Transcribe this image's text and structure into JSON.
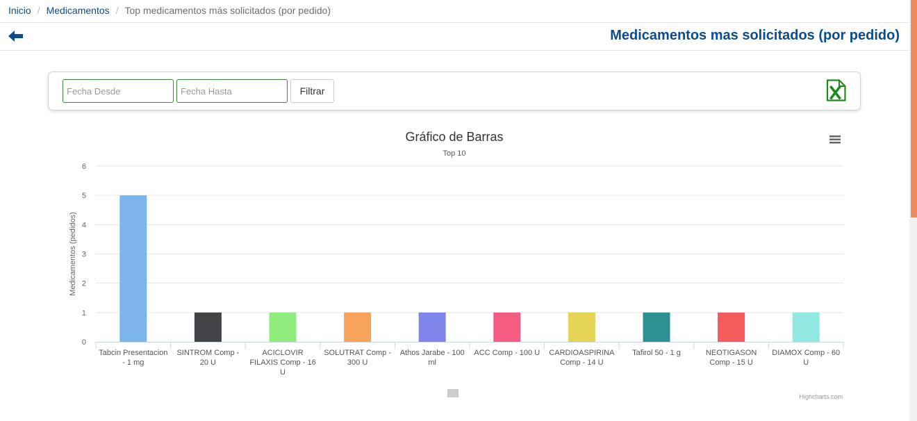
{
  "breadcrumb": {
    "items": [
      "Inicio",
      "Medicamentos"
    ],
    "current": "Top medicamentos más solicitados (por pedido)",
    "separator": "/"
  },
  "header": {
    "title": "Medicamentos mas solicitados (por pedido)",
    "back_icon": "arrow-left-icon"
  },
  "filters": {
    "fecha_desde_placeholder": "Fecha Desde",
    "fecha_hasta_placeholder": "Fecha Hasta",
    "filter_button": "Filtrar",
    "export_icon": "excel-icon"
  },
  "colors": {
    "brand": "#0b4c8c",
    "input_border": "#3a8a3a",
    "excel": "#1e8a1e",
    "scrollbar_thumb": "#ee8a5c"
  },
  "chart_data": {
    "type": "bar",
    "title": "Gráfico de Barras",
    "subtitle": "Top 10",
    "xlabel": "",
    "ylabel": "Medicamentos (pedidos)",
    "ylim": [
      0,
      6
    ],
    "yticks": [
      0,
      1,
      2,
      3,
      4,
      5,
      6
    ],
    "grid": true,
    "categories": [
      "Tabcin Presentacion - 1 mg",
      "SINTROM Comp - 20 U",
      "ACICLOVIR FILAXIS Comp - 16 U",
      "SOLUTRAT Comp - 300 U",
      "Athos Jarabe - 100 ml",
      "ACC Comp - 100 U",
      "CARDIOASPIRINA Comp - 14 U",
      "Tafirol 50 - 1 g",
      "NEOTIGASON Comp - 15 U",
      "DIAMOX Comp - 60 U"
    ],
    "values": [
      5,
      1,
      1,
      1,
      1,
      1,
      1,
      1,
      1,
      1
    ],
    "bar_colors": [
      "#7cb5ec",
      "#434348",
      "#90ed7d",
      "#f7a35c",
      "#8085e9",
      "#f15c80",
      "#e4d354",
      "#2b908f",
      "#f45b5b",
      "#91e8e1"
    ],
    "menu_icon": "hamburger-menu-icon",
    "credits": "Highcharts.com"
  }
}
